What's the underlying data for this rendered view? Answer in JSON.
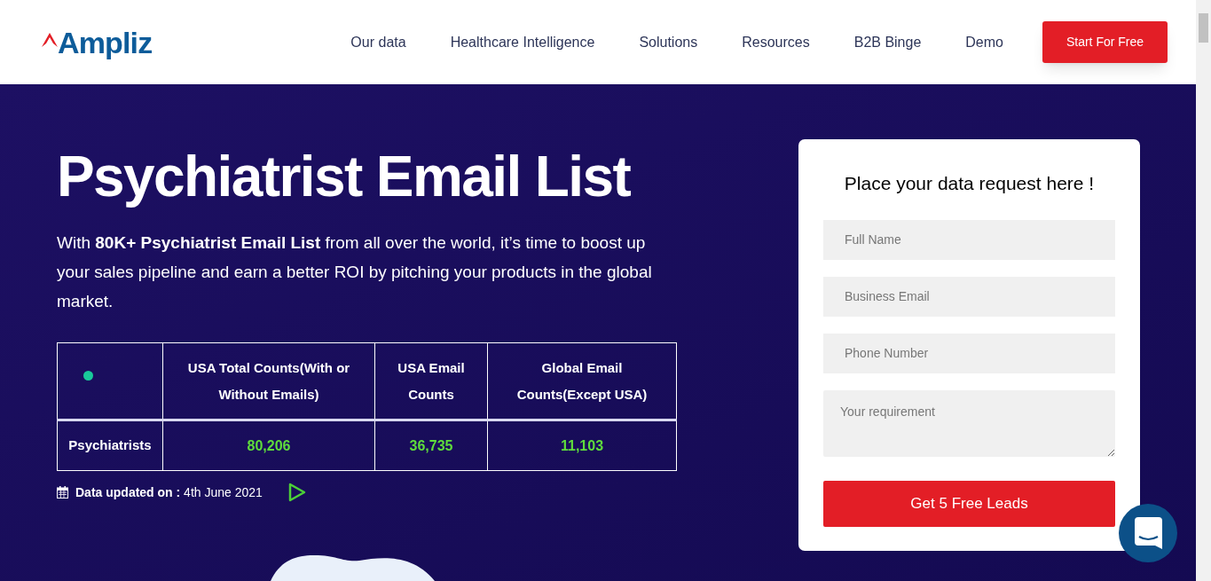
{
  "header": {
    "logo": "Ampliz",
    "nav": [
      "Our data",
      "Healthcare Intelligence",
      "Solutions",
      "Resources",
      "B2B Binge",
      "Demo"
    ],
    "cta": "Start For Free"
  },
  "hero": {
    "title": "Psychiatrist Email List",
    "description": "With **80K+ Psychiatrist Email List** from all over the world, it’s time to boost up your sales pipeline and earn a better ROI by pitching your products in the global market."
  },
  "table": {
    "columns": [
      "USA Total Counts(With or Without Emails)",
      "USA Email Counts",
      "Global Email Counts(Except USA)"
    ],
    "rows": [
      {
        "label": "Psychiatrists",
        "cells": [
          "80,206",
          "36,735",
          "11,103"
        ]
      }
    ]
  },
  "updated": "**Data updated on :** 4th June 2021",
  "form": {
    "title": "Place your data request here !",
    "fields": [
      {
        "kind": "input",
        "placeholder": "Full Name"
      },
      {
        "kind": "input",
        "placeholder": "Business Email"
      },
      {
        "kind": "input",
        "placeholder": "Phone Number"
      },
      {
        "kind": "textarea",
        "placeholder": "Your requirement"
      }
    ],
    "submit": "Get 5 Free Leads"
  }
}
